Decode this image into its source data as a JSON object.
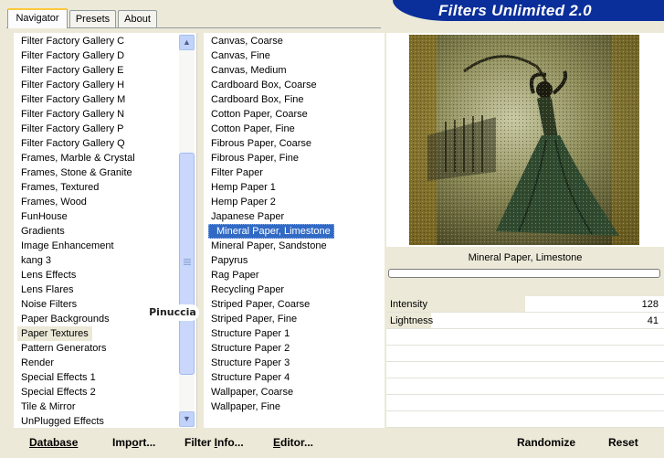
{
  "tabs": [
    {
      "label": "Navigator",
      "active": true
    },
    {
      "label": "Presets",
      "active": false
    },
    {
      "label": "About",
      "active": false
    }
  ],
  "header": {
    "title": "Filters Unlimited 2.0",
    "color": "#0b2f9a"
  },
  "categories": [
    "Filter Factory Gallery C",
    "Filter Factory Gallery D",
    "Filter Factory Gallery E",
    "Filter Factory Gallery H",
    "Filter Factory Gallery M",
    "Filter Factory Gallery N",
    "Filter Factory Gallery P",
    "Filter Factory Gallery Q",
    "Frames, Marble & Crystal",
    "Frames, Stone & Granite",
    "Frames, Textured",
    "Frames, Wood",
    "FunHouse",
    "Gradients",
    "Image Enhancement",
    "kang 3",
    "Lens Effects",
    "Lens Flares",
    "Noise Filters",
    "Paper Backgrounds",
    "Paper Textures",
    "Pattern Generators",
    "Render",
    "Special Effects 1",
    "Special Effects 2",
    "Tile & Mirror",
    "UnPlugged Effects"
  ],
  "selected_category": "Paper Textures",
  "filters": [
    "Canvas, Coarse",
    "Canvas, Fine",
    "Canvas, Medium",
    "Cardboard Box, Coarse",
    "Cardboard Box, Fine",
    "Cotton Paper, Coarse",
    "Cotton Paper, Fine",
    "Fibrous Paper, Coarse",
    "Fibrous Paper, Fine",
    "Filter Paper",
    "Hemp Paper 1",
    "Hemp Paper 2",
    "Japanese Paper",
    "Mineral Paper, Limestone",
    "Mineral Paper, Sandstone",
    "Papyrus",
    "Rag Paper",
    "Recycling Paper",
    "Striped Paper, Coarse",
    "Striped Paper, Fine",
    "Structure Paper 1",
    "Structure Paper 2",
    "Structure Paper 3",
    "Structure Paper 4",
    "Wallpaper, Coarse",
    "Wallpaper, Fine"
  ],
  "selected_filter": "Mineral Paper, Limestone",
  "watermark": "Pinuccia",
  "preview": {
    "filter_name": "Mineral Paper, Limestone"
  },
  "parameters": [
    {
      "name": "Intensity",
      "value": "128",
      "fraction": 0.5
    },
    {
      "name": "Lightness",
      "value": "41",
      "fraction": 0.16
    }
  ],
  "buttons": {
    "database": {
      "accel": "D",
      "rest": "atabase"
    },
    "import": {
      "prefix": "Imp",
      "accel": "o",
      "rest": "rt..."
    },
    "filter_info": {
      "prefix": "Filter ",
      "accel": "I",
      "rest": "nfo..."
    },
    "editor": {
      "accel": "E",
      "rest": "ditor..."
    },
    "randomize": "Randomize",
    "reset": "Reset"
  },
  "scrollbar": {
    "up_icon": "chevron-up-icon",
    "down_icon": "chevron-down-icon"
  },
  "colors": {
    "selection": "#316ac5",
    "background": "#ece9d8"
  }
}
